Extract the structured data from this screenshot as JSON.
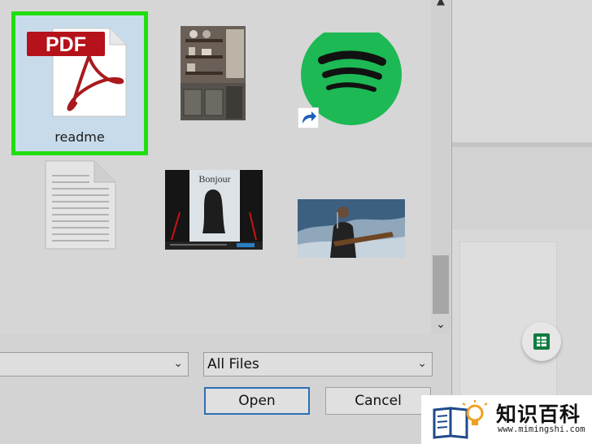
{
  "files": [
    {
      "name": "readme",
      "type": "pdf",
      "selected": true
    },
    {
      "name": "",
      "type": "image-kitchen-shelves"
    },
    {
      "name": "",
      "type": "spotify-shortcut"
    },
    {
      "name": "",
      "type": "text-document"
    },
    {
      "name": "",
      "type": "image-bonjour-slide",
      "slide_title": "Bonjour"
    },
    {
      "name": "",
      "type": "image-concert-guitarist"
    }
  ],
  "pdf_badge": "PDF",
  "filename_field": {
    "value": ""
  },
  "filetype_filter": {
    "value": "All Files"
  },
  "buttons": {
    "open": "Open",
    "cancel": "Cancel"
  },
  "watermark": {
    "name": "知识百科",
    "url": "www.mimingshi.com"
  },
  "colors": {
    "selection_border": "#22dd11",
    "spotify_green": "#1db954",
    "pdf_red": "#b5121b",
    "primary_button_border": "#2d6fb3",
    "sheets_green": "#0f7b3f"
  }
}
